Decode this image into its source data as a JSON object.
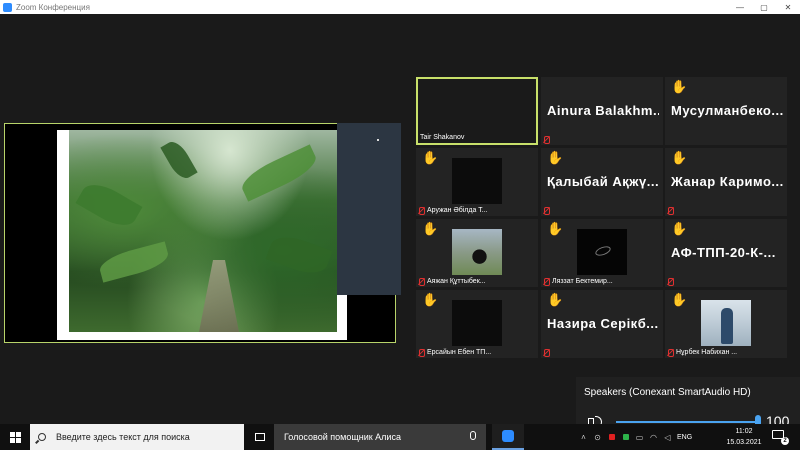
{
  "window": {
    "title": "Zoom Конференция",
    "controls": [
      "—",
      "▢",
      "✕"
    ]
  },
  "shared_screen": {
    "content": "garden-photo"
  },
  "gallery": [
    {
      "name": "Tair Shakanov",
      "display": "",
      "hand": false,
      "muted": false,
      "active": true,
      "video": "none"
    },
    {
      "name": "",
      "display": "Ainura Balakhm...",
      "hand": false,
      "muted": true,
      "active": false,
      "video": "none"
    },
    {
      "name": "",
      "display": "Мусулманбеко...",
      "hand": true,
      "muted": false,
      "active": false,
      "video": "none"
    },
    {
      "name": "Аружан Әбілда Т...",
      "display": "",
      "hand": true,
      "hand_tone": "pale",
      "muted": true,
      "active": false,
      "video": "dark"
    },
    {
      "name": "",
      "display": "Қалыбай Ақжү...",
      "hand": true,
      "muted": true,
      "active": false,
      "video": "none"
    },
    {
      "name": "",
      "display": "Жанар Каримо...",
      "hand": true,
      "muted": true,
      "active": false,
      "video": "none"
    },
    {
      "name": "Аяжан Құттыбек...",
      "display": "",
      "hand": true,
      "muted": true,
      "active": false,
      "video": "dog"
    },
    {
      "name": "Ляззат Бектемир...",
      "display": "",
      "hand": true,
      "muted": true,
      "active": false,
      "video": "dark-logo"
    },
    {
      "name": "",
      "display": "АФ-ТПП-20-К-...",
      "hand": true,
      "muted": true,
      "active": false,
      "video": "none"
    },
    {
      "name": "Ерсайын Ебен ТП...",
      "display": "",
      "hand": true,
      "muted": true,
      "active": false,
      "video": "dark"
    },
    {
      "name": "",
      "display": "Назира Серікб...",
      "hand": true,
      "muted": true,
      "active": false,
      "video": "none"
    },
    {
      "name": "Нұрбек Набихан ...",
      "display": "",
      "hand": true,
      "muted": true,
      "active": false,
      "video": "person"
    }
  ],
  "volume": {
    "device": "Speakers (Conexant SmartAudio HD)",
    "value": "100",
    "level": 1.0
  },
  "taskbar": {
    "search_placeholder": "Введите здесь текст для поиска",
    "assistant": "Голосовой помощник Алиса",
    "lang": "ENG",
    "time": "11:02",
    "date": "15.03.2021",
    "notifications": "2"
  },
  "colors": {
    "active_border": "#c8e06a",
    "hand": "#f0c020",
    "muted": "#e03030",
    "accent": "#4aa3f0"
  }
}
